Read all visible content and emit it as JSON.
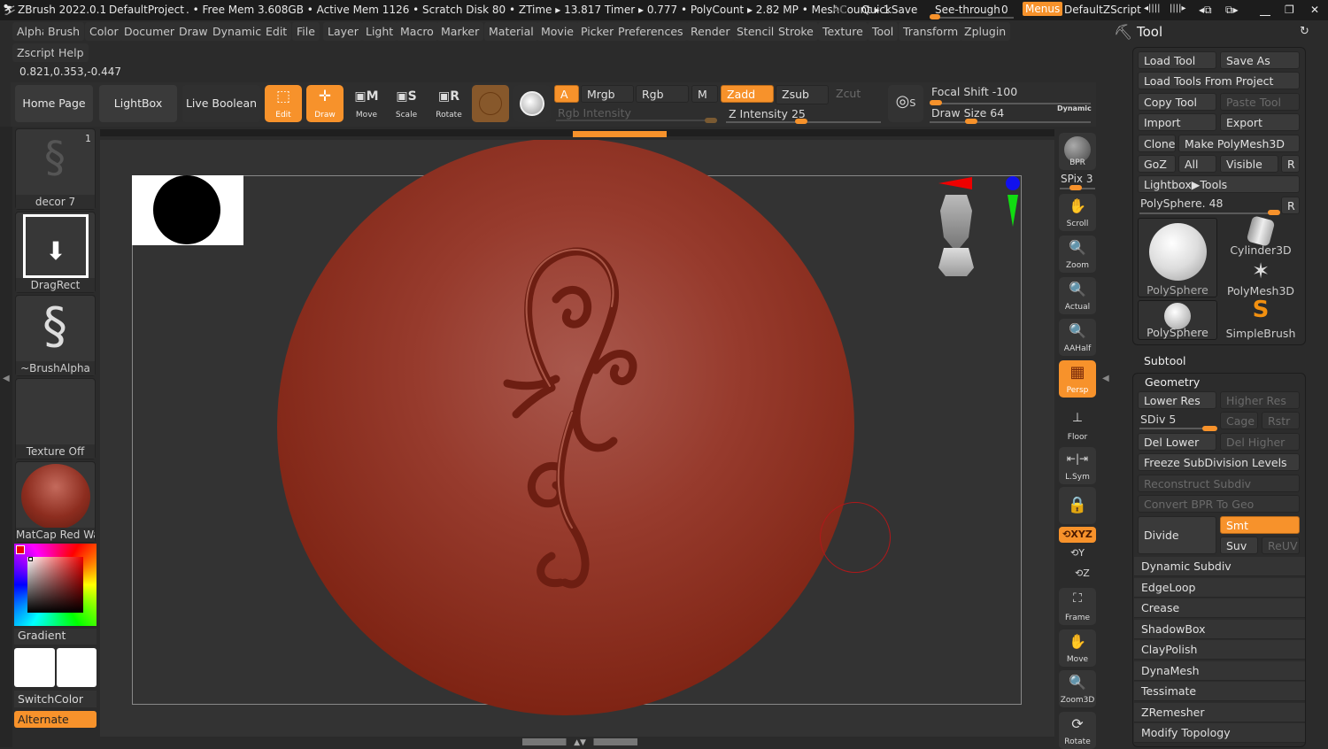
{
  "titlebar": {
    "app": "ZBrush 2022.0.1",
    "project": "DefaultProject",
    "stats": ". • Free Mem 3.608GB • Active Mem 1126 • Scratch Disk 80 •  ZTime ▸ 13.817 Timer ▸ 0.777 • PolyCount ▸ 2.82 MP  • MeshCount ▸ 1",
    "ac": "AC",
    "quicksave": "QuickSave",
    "see_through_label": "See-through",
    "see_through_value": "0",
    "menus": "Menus",
    "zscript": "DefaultZScript"
  },
  "menu": {
    "row1": [
      "Alpha",
      "Brush",
      "Color",
      "Document",
      "Draw",
      "Dynamics",
      "Edit",
      "File",
      "Layer",
      "Light",
      "Macro",
      "Marker",
      "Material",
      "Movie",
      "Picker",
      "Preferences",
      "Render",
      "Stencil",
      "Stroke",
      "Texture",
      "Tool",
      "Transform",
      "Zplugin"
    ],
    "row2": [
      "Zscript",
      "Help"
    ]
  },
  "coords": "0.821,0.353,-0.447",
  "toolbar": {
    "home_page": "Home Page",
    "lightbox": "LightBox",
    "live_boolean": "Live Boolean",
    "edit": "Edit",
    "draw": "Draw",
    "move": "Move",
    "scale": "Scale",
    "rotate": "Rotate",
    "a": "A",
    "mrgb": "Mrgb",
    "rgb": "Rgb",
    "m": "M",
    "zadd": "Zadd",
    "zsub": "Zsub",
    "zcut": "Zcut",
    "rgb_intensity": "Rgb Intensity",
    "z_intensity_label": "Z Intensity",
    "z_intensity_value": "25",
    "focal_shift_label": "Focal Shift",
    "focal_shift_value": "-100",
    "draw_size_label": "Draw Size",
    "draw_size_value": "64",
    "dynamic": "Dynamic"
  },
  "left_shelf": {
    "brush_count": "1",
    "brush": "decor  7",
    "stroke": "DragRect",
    "alpha": "~BrushAlpha",
    "texture": "Texture Off",
    "material": "MatCap Red Wax",
    "gradient": "Gradient",
    "switch_color": "SwitchColor",
    "alternate": "Alternate"
  },
  "right_shelf": {
    "bpr": "BPR",
    "spix": "SPix 3",
    "scroll": "Scroll",
    "zoom": "Zoom",
    "actual": "Actual",
    "aahalf": "AAHalf",
    "persp": "Persp",
    "floor": "Floor",
    "lsym": "L.Sym",
    "xyz": "XYZ",
    "y": "Y",
    "z": "Z",
    "frame": "Frame",
    "move": "Move",
    "zoom3d": "Zoom3D",
    "rotate": "Rotate"
  },
  "tool_panel": {
    "title": "Tool",
    "load_tool": "Load Tool",
    "save_as": "Save As",
    "load_tools_from_project": "Load Tools From Project",
    "copy_tool": "Copy Tool",
    "paste_tool": "Paste Tool",
    "import": "Import",
    "export": "Export",
    "clone": "Clone",
    "make_polymesh": "Make PolyMesh3D",
    "goz": "GoZ",
    "all": "All",
    "visible": "Visible",
    "r": "R",
    "lightbox_tools": "Lightbox▶Tools",
    "current_tool": "PolySphere. 48",
    "tools": [
      "PolySphere",
      "Cylinder3D",
      "PolyMesh3D",
      "PolySphere",
      "SimpleBrush"
    ],
    "subtool": "Subtool",
    "geometry": "Geometry",
    "lower_res": "Lower Res",
    "higher_res": "Higher Res",
    "sdiv": "SDiv 5",
    "cage": "Cage",
    "rstr": "Rstr",
    "del_lower": "Del Lower",
    "del_higher": "Del Higher",
    "freeze": "Freeze SubDivision Levels",
    "reconstruct": "Reconstruct Subdiv",
    "convert_bpr": "Convert BPR To Geo",
    "divide": "Divide",
    "smt": "Smt",
    "suv": "Suv",
    "reuv": "ReUV",
    "sections": [
      "Dynamic Subdiv",
      "EdgeLoop",
      "Crease",
      "ShadowBox",
      "ClayPolish",
      "DynaMesh",
      "Tessimate",
      "ZRemesher",
      "Modify Topology"
    ]
  },
  "colors": {
    "accent": "#f7922b",
    "material": "#9a3422"
  }
}
